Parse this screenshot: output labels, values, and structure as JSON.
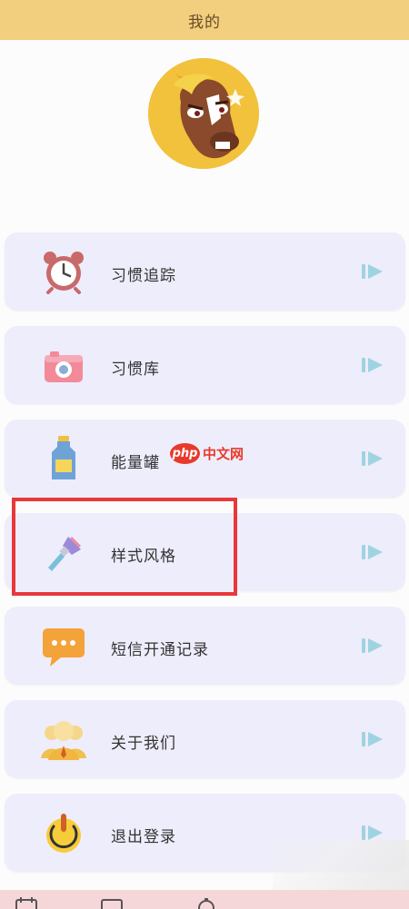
{
  "header": {
    "title": "我的"
  },
  "watermark": {
    "brand": "php",
    "text": "中文网"
  },
  "menu": [
    {
      "label": "习惯追踪",
      "icon": "alarm-clock-icon"
    },
    {
      "label": "习惯库",
      "icon": "camera-icon"
    },
    {
      "label": "能量罐",
      "icon": "bottle-icon"
    },
    {
      "label": "样式风格",
      "icon": "paintbrush-icon"
    },
    {
      "label": "短信开通记录",
      "icon": "message-bubble-icon"
    },
    {
      "label": "关于我们",
      "icon": "team-icon"
    },
    {
      "label": "退出登录",
      "icon": "power-icon"
    }
  ],
  "colors": {
    "header": "#f1cf7e",
    "card": "#eeedfb",
    "highlight": "#e8383a",
    "arrow": "#9fd3e0",
    "bottom_bar": "#f6d7d9"
  }
}
